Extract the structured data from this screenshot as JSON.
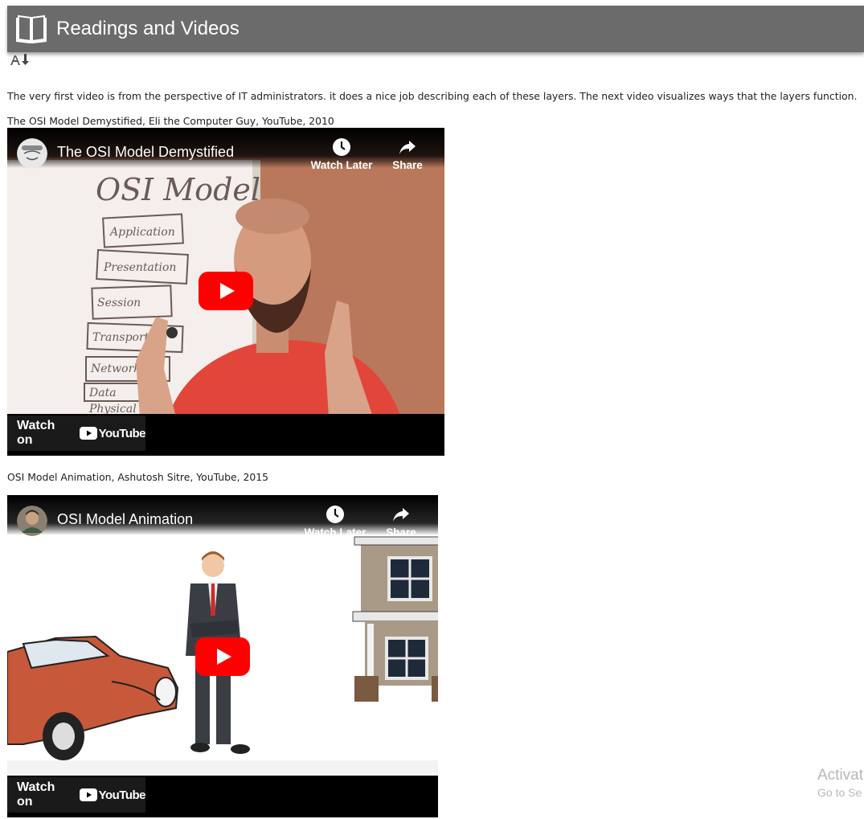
{
  "header": {
    "title": "Readings and Videos",
    "icon": "open-book-icon"
  },
  "intro_text": "The very first video is from the perspective of IT administrators. it does a nice job describing each of these layers. The next video visualizes ways that the layers function.",
  "videos": [
    {
      "citation": "The OSI Model Demystified, Eli the Computer Guy, YouTube, 2010",
      "title": "The OSI Model Demystified",
      "watch_later": "Watch Later",
      "share": "Share",
      "watch_on": "Watch on",
      "youtube": "YouTube",
      "whiteboard_heading": "OSI Model",
      "layers": [
        "Application",
        "Presentation",
        "Session",
        "Transport",
        "Network",
        "Data",
        "Physical"
      ]
    },
    {
      "citation": "OSI Model Animation, Ashutosh Sitre, YouTube, 2015",
      "title": "OSI Model Animation",
      "watch_later": "Watch Later",
      "share": "Share",
      "watch_on": "Watch on",
      "youtube": "YouTube"
    }
  ],
  "watermark": {
    "line1": "Activat",
    "line2": "Go to Se"
  },
  "colors": {
    "header_bg": "#6b6b6b",
    "youtube_red": "#ff0000"
  }
}
